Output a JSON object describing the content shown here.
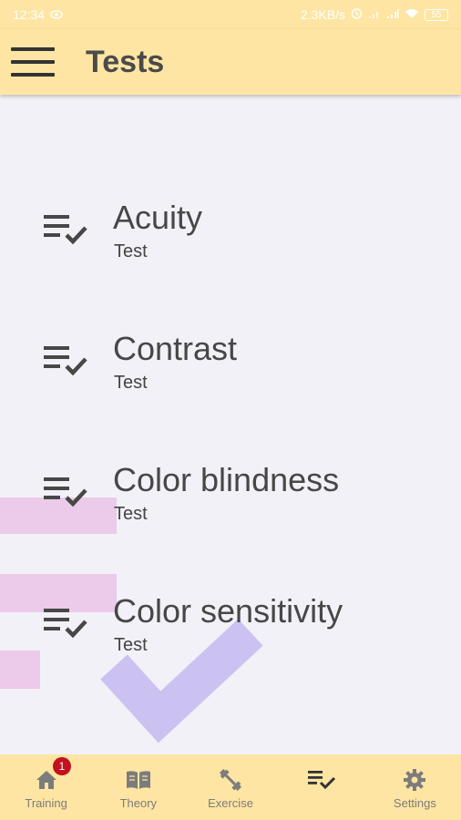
{
  "status_bar": {
    "time": "12:34",
    "net_speed": "2.3KB/s",
    "battery": "55",
    "icons": [
      "eye-icon",
      "alarm-icon",
      "signal-icon",
      "signal-icon",
      "wifi-icon",
      "battery-icon"
    ]
  },
  "app_bar": {
    "title": "Tests",
    "menu_icon": "hamburger-menu-icon"
  },
  "tests": [
    {
      "title": "Acuity",
      "subtitle": "Test",
      "icon": "checklist-icon"
    },
    {
      "title": "Contrast",
      "subtitle": "Test",
      "icon": "checklist-icon"
    },
    {
      "title": "Color blindness",
      "subtitle": "Test",
      "icon": "checklist-icon"
    },
    {
      "title": "Color sensitivity",
      "subtitle": "Test",
      "icon": "checklist-icon"
    }
  ],
  "bottom_nav": {
    "items": [
      {
        "label": "Training",
        "icon": "home-icon",
        "badge": "1"
      },
      {
        "label": "Theory",
        "icon": "book-icon"
      },
      {
        "label": "Exercise",
        "icon": "dumbbell-icon"
      },
      {
        "label": "",
        "icon": "checklist-icon",
        "selected": true
      },
      {
        "label": "Settings",
        "icon": "gear-icon"
      }
    ]
  },
  "colors": {
    "app_bar": "#fee5a3",
    "background": "#f2f1f7",
    "badge": "#c0121f",
    "decor_pink": "#ebc3e6",
    "decor_purple": "#c9bff0"
  }
}
